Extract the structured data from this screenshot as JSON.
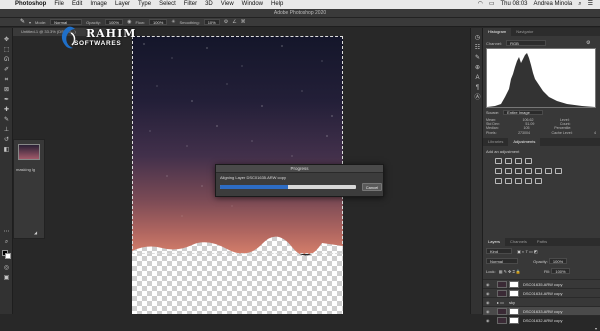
{
  "menubar": {
    "apple": "",
    "app": "Photoshop",
    "items": [
      "File",
      "Edit",
      "Image",
      "Layer",
      "Type",
      "Select",
      "Filter",
      "3D",
      "View",
      "Window",
      "Help"
    ],
    "clock": "Thu 08:03",
    "user": "Andrea Minola"
  },
  "window": {
    "title": "Adobe Photoshop 2020"
  },
  "options": {
    "mode_label": "Mode:",
    "mode_value": "Normal",
    "opacity_label": "Opacity:",
    "opacity_value": "100%",
    "flow_label": "Flow:",
    "flow_value": "100%",
    "smoothing_label": "Smoothing:",
    "smoothing_value": "10%"
  },
  "document": {
    "tab": "Untitled-1 @ 33.3% (DSC01...)"
  },
  "logo": {
    "line1": "RAHIM",
    "line2": "SOFTWARES"
  },
  "thumbnail": {
    "label": "masking lg"
  },
  "progress": {
    "title": "Progress",
    "message": "Aligning Layer DSC01635.ARW copy",
    "value": 0.5,
    "cancel": "Cancel"
  },
  "histogram": {
    "tabs": [
      "Histogram",
      "Navigator"
    ],
    "channel_label": "Channel:",
    "channel_value": "RGB",
    "source_label": "Source:",
    "source_value": "Entire Image",
    "stats": [
      [
        "Mean:",
        "106.62",
        "Level:",
        ""
      ],
      [
        "Std Dev:",
        "51.09",
        "Count:",
        ""
      ],
      [
        "Median:",
        "105",
        "Percentile:",
        ""
      ],
      [
        "Pixels:",
        "273004",
        "Cache Level:",
        "4"
      ]
    ]
  },
  "adjustments": {
    "tabs": [
      "Libraries",
      "Adjustments"
    ],
    "title": "Add an adjustment"
  },
  "layers": {
    "tabs": [
      "Layers",
      "Channels",
      "Paths"
    ],
    "kind": "Kind",
    "blend": "Normal",
    "opacity_label": "Opacity:",
    "opacity_value": "100%",
    "lock_label": "Lock:",
    "fill_label": "Fill:",
    "fill_value": "100%",
    "rows": [
      {
        "name": "DSC01635.ARW copy"
      },
      {
        "name": "DSC01634.ARW copy"
      },
      {
        "name": "sky"
      },
      {
        "name": "DSC01633.ARW copy"
      },
      {
        "name": "DSC01632.ARW copy"
      }
    ]
  },
  "colors": {
    "accent": "#2d6cc4",
    "menubar": "#e9e9e9",
    "workspace": "#282828",
    "panel": "#383838"
  }
}
